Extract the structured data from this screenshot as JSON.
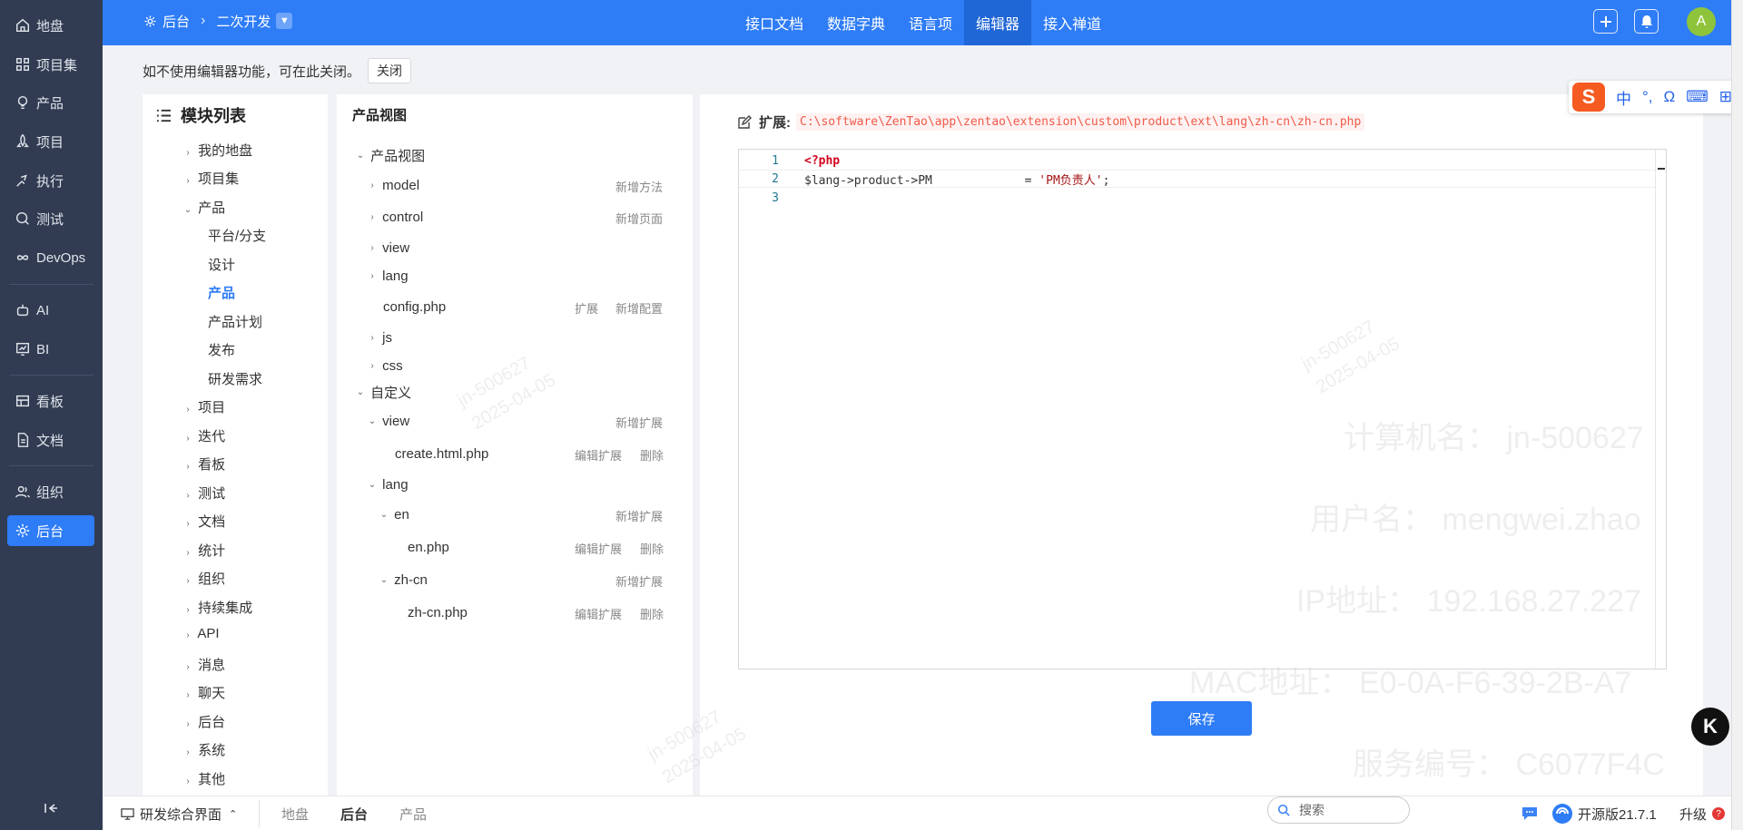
{
  "nav": {
    "items": [
      {
        "label": "地盘",
        "icon": "home-icon"
      },
      {
        "label": "项目集",
        "icon": "grid-icon"
      },
      {
        "label": "产品",
        "icon": "bulb-icon"
      },
      {
        "label": "项目",
        "icon": "rocket-icon"
      },
      {
        "label": "执行",
        "icon": "run-icon"
      },
      {
        "label": "测试",
        "icon": "search-icon"
      },
      {
        "label": "DevOps",
        "icon": "infinity-icon"
      },
      {
        "label": "AI",
        "icon": "robot-icon"
      },
      {
        "label": "BI",
        "icon": "chart-icon"
      },
      {
        "label": "看板",
        "icon": "kanban-icon"
      },
      {
        "label": "文档",
        "icon": "doc-icon"
      },
      {
        "label": "组织",
        "icon": "users-icon"
      },
      {
        "label": "后台",
        "icon": "gear-icon"
      }
    ],
    "active": "后台"
  },
  "header": {
    "breadcrumb": [
      "后台",
      "二次开发"
    ],
    "tabs": [
      "接口文档",
      "数据字典",
      "语言项",
      "编辑器",
      "接入禅道"
    ],
    "active_tab": "编辑器",
    "avatar": "A",
    "accent": "#2e7cf6"
  },
  "notice": {
    "text": "如不使用编辑器功能，可在此关闭。",
    "close_label": "关闭"
  },
  "modules": {
    "title": "模块列表",
    "items": [
      "我的地盘",
      "项目集",
      "产品",
      "平台/分支",
      "设计",
      "产品",
      "产品计划",
      "发布",
      "研发需求",
      "项目",
      "迭代",
      "看板",
      "测试",
      "文档",
      "统计",
      "组织",
      "持续集成",
      "API",
      "消息",
      "聊天",
      "后台",
      "系统",
      "其他"
    ]
  },
  "view": {
    "title": "产品视图",
    "rows": [
      "产品视图",
      "model",
      "control",
      "view",
      "lang",
      "config.php",
      "js",
      "css",
      "自定义",
      "view",
      "create.html.php",
      "lang",
      "en",
      "en.php",
      "zh-cn",
      "zh-cn.php"
    ],
    "actions": {
      "add_method": "新增方法",
      "add_page": "新增页面",
      "extend": "扩展",
      "add_config": "新增配置",
      "add_extension": "新增扩展",
      "edit_extension": "编辑扩展",
      "delete": "删除"
    }
  },
  "editor": {
    "ext_label": "扩展:",
    "path": "C:\\software\\ZenTao\\app\\zentao\\extension\\custom\\product\\ext\\lang\\zh-cn\\zh-cn.php",
    "line_numbers": [
      "1",
      "2",
      "3"
    ],
    "code": {
      "open_tag": "<?php",
      "var": "$lang->product->PM",
      "op": "             = ",
      "value": "'PM负责人'",
      "end": ";"
    },
    "save_label": "保存"
  },
  "footer": {
    "workspace": "研发综合界面",
    "tabs": [
      "地盘",
      "后台",
      "产品"
    ],
    "active_tab": "后台",
    "search_placeholder": "搜索",
    "version": "开源版21.7.1",
    "upgrade": "升级"
  },
  "ime": {
    "logo": "S",
    "mode": "中"
  },
  "watermark": {
    "stamp": "jn-500627",
    "date": "2025-04-05",
    "lines": [
      "计算机名：   jn-500627",
      "用户名：   mengwei.zhao",
      "IP地址：   192.168.27.227",
      "MAC地址：   E0-0A-F6-39-2B-A7",
      "服务编号：   C6077F4C"
    ]
  },
  "badge": "K"
}
